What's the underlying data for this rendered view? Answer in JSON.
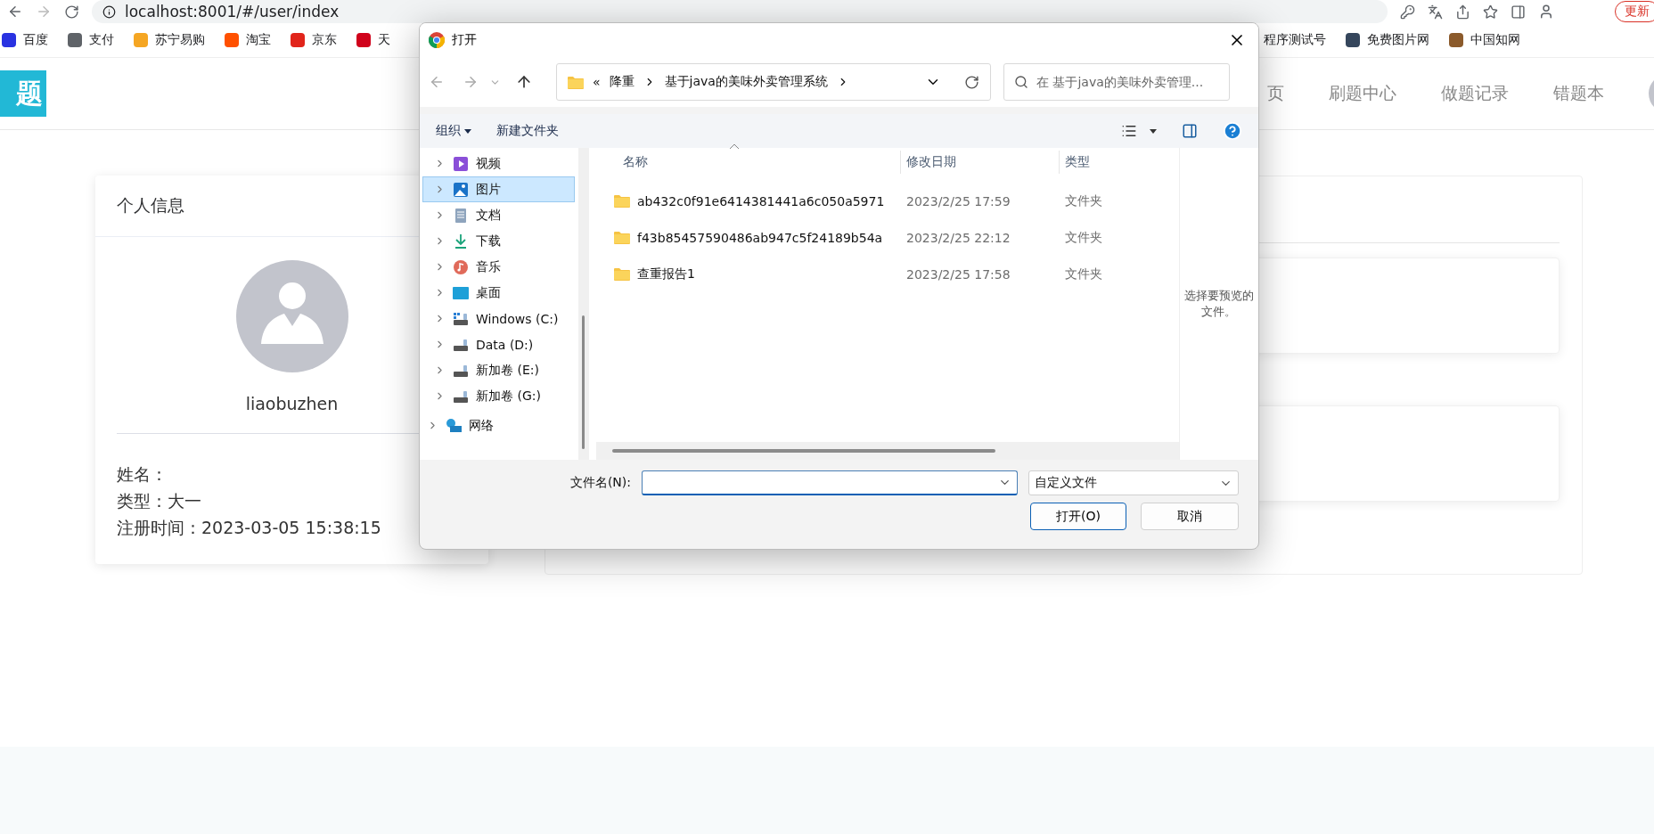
{
  "browser": {
    "url": "localhost:8001/#/user/index",
    "update_button": "更新",
    "bookmarks": [
      {
        "label": "百度",
        "color": "#2932e1"
      },
      {
        "label": "支付",
        "color": "#5f6368"
      },
      {
        "label": "苏宁易购",
        "color": "#f5a623"
      },
      {
        "label": "淘宝",
        "color": "#ff5000"
      },
      {
        "label": "京东",
        "color": "#e1251b"
      },
      {
        "label": "天",
        "color": "#d0021b"
      },
      {
        "label": "程序测试号"
      },
      {
        "label": "免费图片网",
        "color": "#35465c"
      },
      {
        "label": "中国知网",
        "color": "#8b5a2b"
      }
    ]
  },
  "site": {
    "logo": "题",
    "nav": [
      {
        "label": "页"
      },
      {
        "label": "刷题中心"
      },
      {
        "label": "做题记录"
      },
      {
        "label": "错题本"
      }
    ]
  },
  "profile_card": {
    "title": "个人信息",
    "username": "liaobuzhen",
    "lines": [
      "姓名：",
      "类型：大一",
      "注册时间：2023-03-05 15:38:15"
    ]
  },
  "dialog": {
    "title": "打开",
    "overflow_mark": "«",
    "breadcrumb": [
      "降重",
      "基于java的美味外卖管理系统"
    ],
    "search_placeholder": "在 基于java的美味外卖管理...",
    "toolbar": [
      {
        "label": "组织",
        "menu": true
      },
      {
        "label": "新建文件夹",
        "menu": false
      }
    ],
    "nav": [
      {
        "label": "视频",
        "kind": "video",
        "selected": false
      },
      {
        "label": "图片",
        "kind": "pictures",
        "selected": true
      },
      {
        "label": "文档",
        "kind": "documents",
        "selected": false
      },
      {
        "label": "下载",
        "kind": "download",
        "selected": false
      },
      {
        "label": "音乐",
        "kind": "music",
        "selected": false
      },
      {
        "label": "桌面",
        "kind": "desktop",
        "selected": false
      },
      {
        "label": "Windows (C:)",
        "kind": "system",
        "selected": false
      },
      {
        "label": "Data (D:)",
        "kind": "drive",
        "selected": false
      },
      {
        "label": "新加卷 (E:)",
        "kind": "drive",
        "selected": false
      },
      {
        "label": "新加卷 (G:)",
        "kind": "drive",
        "selected": false
      },
      {
        "label": "网络",
        "kind": "network",
        "selected": false
      }
    ],
    "columns": [
      "名称",
      "修改日期",
      "类型"
    ],
    "files": [
      {
        "name": "ab432c0f91e6414381441a6c050a5971",
        "date": "2023/2/25 17:59",
        "type": "文件夹"
      },
      {
        "name": "f43b85457590486ab947c5f24189b54a",
        "date": "2023/2/25 22:12",
        "type": "文件夹"
      },
      {
        "name": "查重报告1",
        "date": "2023/2/25 17:58",
        "type": "文件夹"
      }
    ],
    "preview_hint": "选择要预览的文件。",
    "filename_label": "文件名(N):",
    "filter": "自定义文件",
    "buttons": [
      {
        "label": "打开(O)",
        "default": true
      },
      {
        "label": "取消",
        "default": false
      }
    ]
  }
}
